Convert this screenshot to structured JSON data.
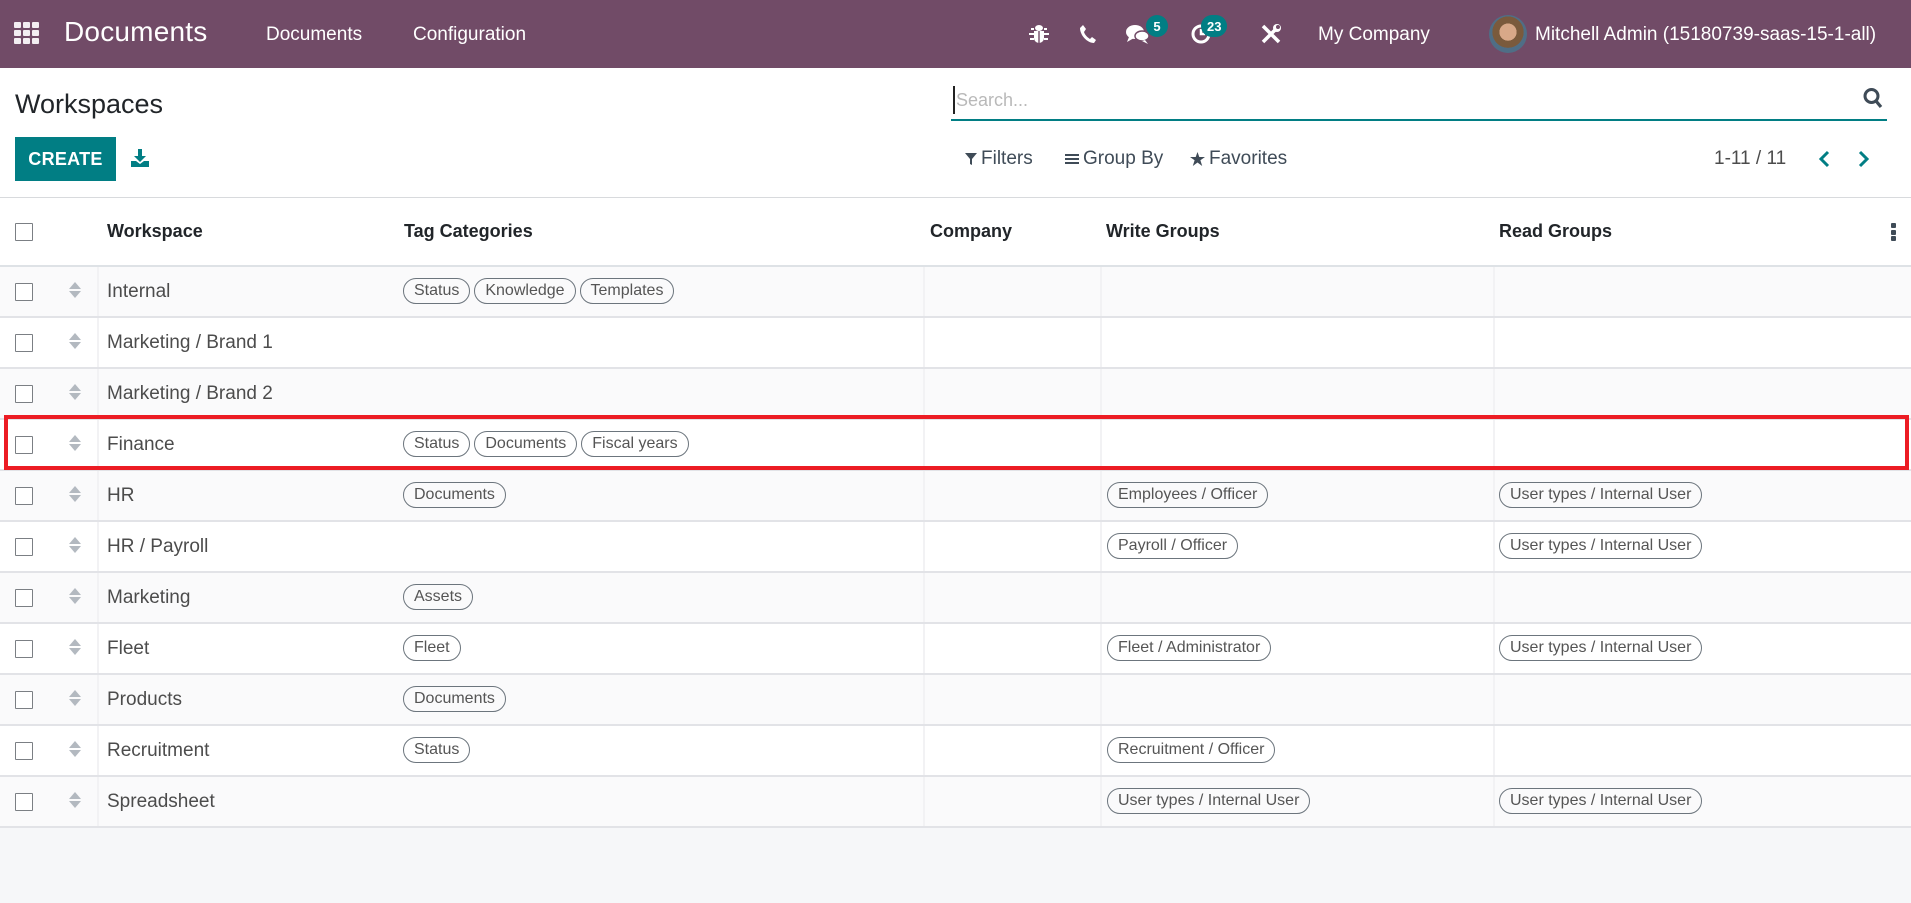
{
  "navbar": {
    "app_title": "Documents",
    "menu": [
      "Documents",
      "Configuration"
    ],
    "icons": [
      "apps-grid-icon",
      "bug-icon",
      "phone-icon",
      "chat-icon",
      "activity-clock-icon",
      "tools-icon"
    ],
    "messages_badge": "5",
    "activities_badge": "23",
    "company": "My Company",
    "user": "Mitchell Admin (15180739-saas-15-1-all)",
    "badge_color": "#017e84",
    "bar_color": "#714b67"
  },
  "control_panel": {
    "title": "Workspaces",
    "create_label": "CREATE",
    "search_placeholder": "Search...",
    "search_value": "",
    "filters_label": "Filters",
    "group_by_label": "Group By",
    "favorites_label": "Favorites",
    "pager": "1-11 / 11"
  },
  "table": {
    "columns": [
      "Workspace",
      "Tag Categories",
      "Company",
      "Write Groups",
      "Read Groups"
    ],
    "rows": [
      {
        "name": "Internal",
        "tags": [
          "Status",
          "Knowledge",
          "Templates"
        ],
        "company": "",
        "write_groups": [],
        "read_groups": []
      },
      {
        "name": "Marketing / Brand 1",
        "tags": [],
        "company": "",
        "write_groups": [],
        "read_groups": []
      },
      {
        "name": "Marketing / Brand 2",
        "tags": [],
        "company": "",
        "write_groups": [],
        "read_groups": []
      },
      {
        "name": "Finance",
        "tags": [
          "Status",
          "Documents",
          "Fiscal years"
        ],
        "company": "",
        "write_groups": [],
        "read_groups": [],
        "highlighted": true
      },
      {
        "name": "HR",
        "tags": [
          "Documents"
        ],
        "company": "",
        "write_groups": [
          "Employees / Officer"
        ],
        "read_groups": [
          "User types / Internal User"
        ]
      },
      {
        "name": "HR / Payroll",
        "tags": [],
        "company": "",
        "write_groups": [
          "Payroll / Officer"
        ],
        "read_groups": [
          "User types / Internal User"
        ]
      },
      {
        "name": "Marketing",
        "tags": [
          "Assets"
        ],
        "company": "",
        "write_groups": [],
        "read_groups": []
      },
      {
        "name": "Fleet",
        "tags": [
          "Fleet"
        ],
        "company": "",
        "write_groups": [
          "Fleet / Administrator"
        ],
        "read_groups": [
          "User types / Internal User"
        ]
      },
      {
        "name": "Products",
        "tags": [
          "Documents"
        ],
        "company": "",
        "write_groups": [],
        "read_groups": []
      },
      {
        "name": "Recruitment",
        "tags": [
          "Status"
        ],
        "company": "",
        "write_groups": [
          "Recruitment / Officer"
        ],
        "read_groups": []
      },
      {
        "name": "Spreadsheet",
        "tags": [],
        "company": "",
        "write_groups": [
          "User types / Internal User"
        ],
        "read_groups": [
          "User types / Internal User"
        ]
      }
    ],
    "highlight_color": "#ec1c24"
  }
}
